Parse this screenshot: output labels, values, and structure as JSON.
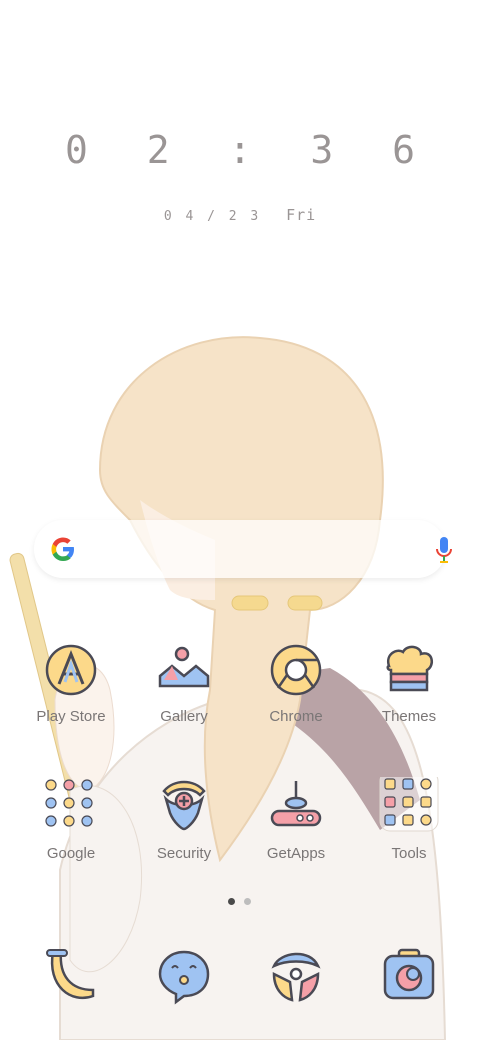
{
  "clock": {
    "time": "0 2 : 3 6",
    "date": "0 4 / 2 3",
    "weekday": "Fri"
  },
  "search": {
    "google_icon": "google-g-icon",
    "mic_icon": "microphone-icon"
  },
  "apps": [
    {
      "label": "Play Store",
      "icon": "play-store-icon"
    },
    {
      "label": "Gallery",
      "icon": "gallery-icon"
    },
    {
      "label": "Chrome",
      "icon": "chrome-icon"
    },
    {
      "label": "Themes",
      "icon": "themes-icon"
    },
    {
      "label": "Google",
      "icon": "google-folder-icon"
    },
    {
      "label": "Security",
      "icon": "security-icon"
    },
    {
      "label": "GetApps",
      "icon": "getapps-icon"
    },
    {
      "label": "Tools",
      "icon": "tools-folder-icon"
    }
  ],
  "page_indicator": {
    "pages": 2,
    "active": 1
  },
  "dock": [
    {
      "icon": "phone-icon"
    },
    {
      "icon": "messages-icon"
    },
    {
      "icon": "browser-icon"
    },
    {
      "icon": "camera-icon"
    }
  ],
  "colors": {
    "icon_yellow": "#fcd98a",
    "icon_blue": "#9fc3f2",
    "icon_pink": "#f5a0a8",
    "outline": "#4a4a55",
    "text": "#7a7676"
  }
}
